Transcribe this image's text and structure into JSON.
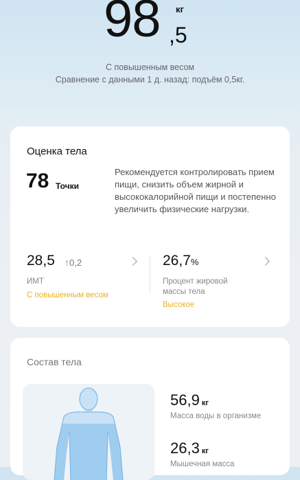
{
  "header": {
    "weight_integer": "98",
    "weight_decimal": ",5",
    "weight_unit": "кг",
    "status": "С повышенным весом",
    "comparison": "Сравнение с данными 1 д. назад: подъём 0,5кг."
  },
  "assessment": {
    "title": "Оценка тела",
    "score": "78",
    "score_unit": "Точки",
    "recommendation": "Рекомендуется контролировать прием пищи, снизить объем жирной и высококалорийной пищи и постепенно увеличить физические нагрузки.",
    "bmi": {
      "value": "28,5",
      "delta_arrow": "↑",
      "delta": "0,2",
      "label": "ИМТ",
      "status": "С повышенным весом"
    },
    "body_fat": {
      "value": "26,7",
      "unit": "%",
      "label": "Процент жировой массы тела",
      "status": "Высокое"
    },
    "status_color": "#e7b320"
  },
  "composition": {
    "title": "Состав тела",
    "figure_fill_color": "#9fcdf0",
    "items": [
      {
        "value": "56,9",
        "unit": "кг",
        "label": "Масса воды в организме"
      },
      {
        "value": "26,3",
        "unit": "кг",
        "label": "Мышечная масса"
      }
    ]
  }
}
